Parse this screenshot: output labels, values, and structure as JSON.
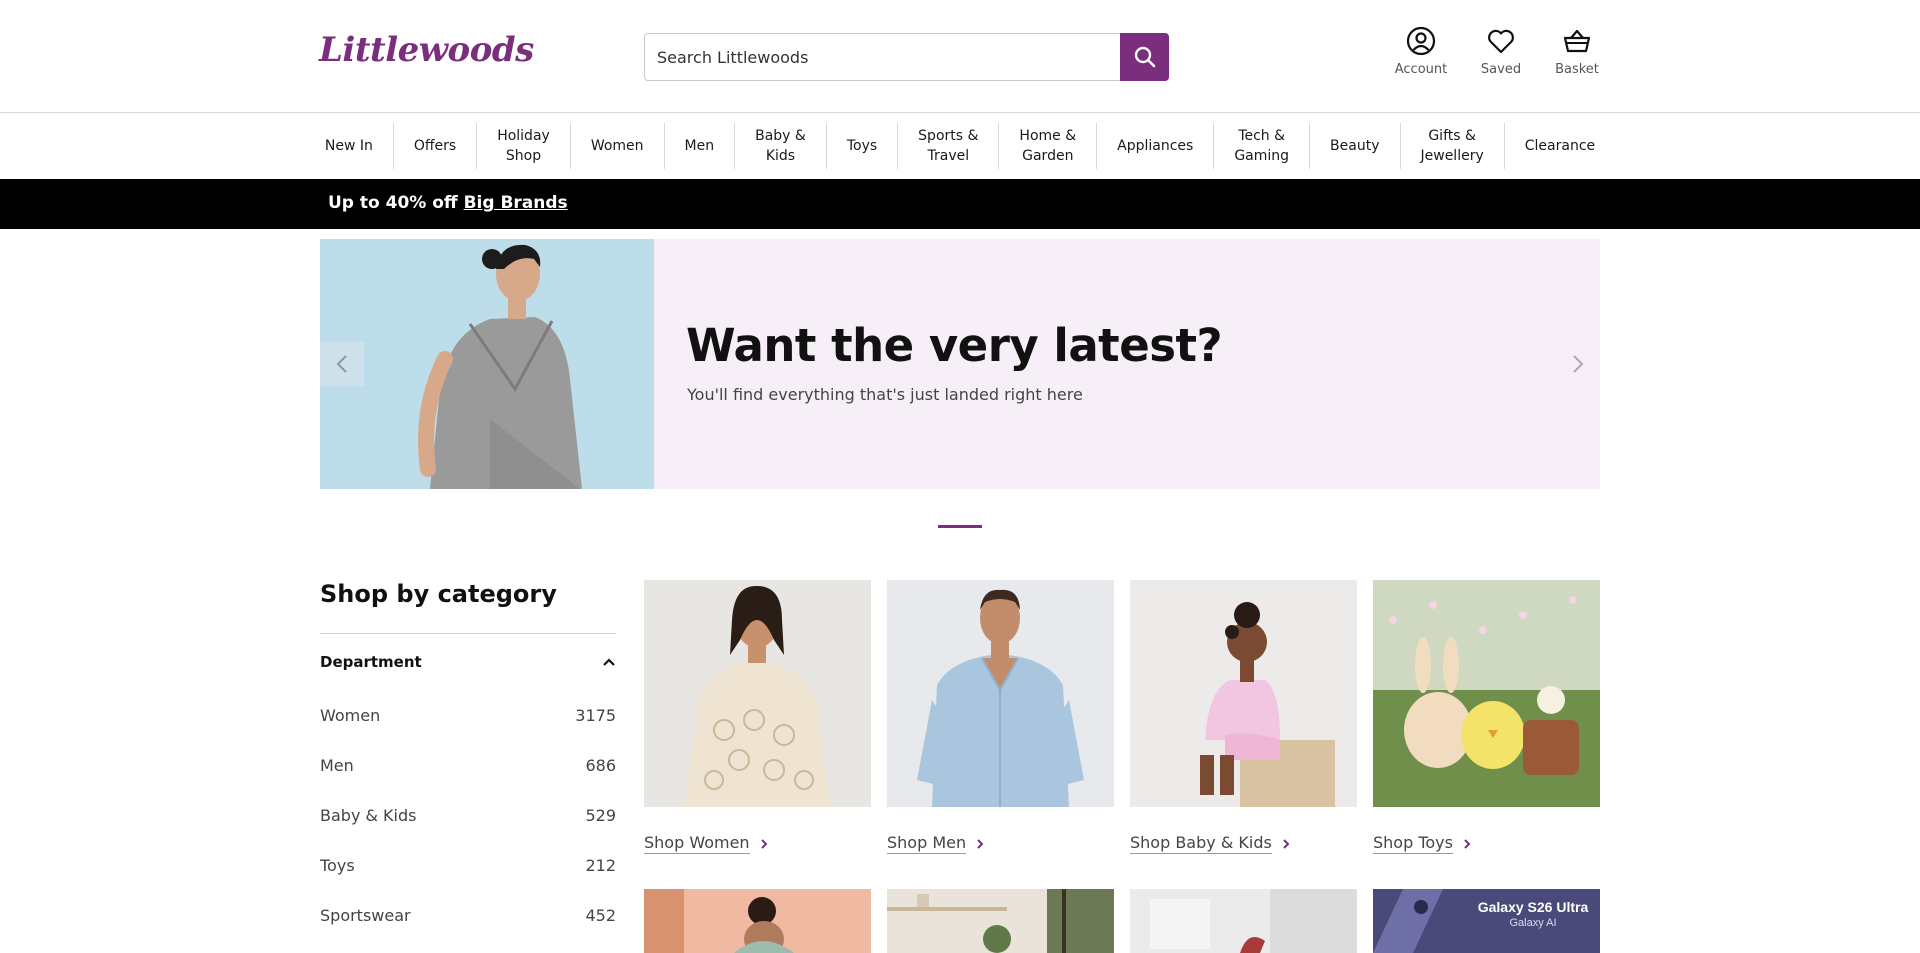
{
  "header": {
    "logo": "Littlewoods",
    "search_placeholder": "Search Littlewoods",
    "account_label": "Account",
    "saved_label": "Saved",
    "basket_label": "Basket"
  },
  "nav": {
    "items": [
      "New In",
      "Offers",
      "Holiday\nShop",
      "Women",
      "Men",
      "Baby &\nKids",
      "Toys",
      "Sports &\nTravel",
      "Home &\nGarden",
      "Appliances",
      "Tech &\nGaming",
      "Beauty",
      "Gifts &\nJewellery",
      "Clearance"
    ]
  },
  "promo": {
    "prefix": "Up to 40% off ",
    "link": "Big Brands"
  },
  "hero": {
    "title": "Want the very latest?",
    "subtitle": "You'll find everything that's just landed right here"
  },
  "sidebar": {
    "title": "Shop by category",
    "section_label": "Department",
    "items": [
      {
        "label": "Women",
        "count": "3175"
      },
      {
        "label": "Men",
        "count": "686"
      },
      {
        "label": "Baby & Kids",
        "count": "529"
      },
      {
        "label": "Toys",
        "count": "212"
      },
      {
        "label": "Sportswear",
        "count": "452"
      }
    ]
  },
  "categories": [
    {
      "label": "Shop Women"
    },
    {
      "label": "Shop Men"
    },
    {
      "label": "Shop Baby & Kids"
    },
    {
      "label": "Shop Toys"
    }
  ],
  "row2": {
    "phone_promo_title": "Galaxy S26 Ultra",
    "phone_promo_sub": "Galaxy AI"
  },
  "colors": {
    "brand": "#7b2d7e",
    "hero_bg": "#f7eff7",
    "promo_bg": "#000000"
  }
}
